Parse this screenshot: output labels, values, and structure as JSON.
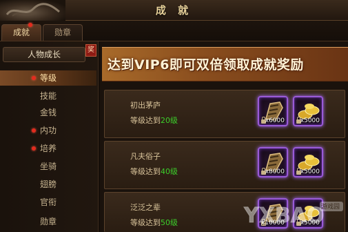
{
  "window": {
    "title": "成 就"
  },
  "tabs": [
    {
      "label": "成就",
      "active": true,
      "has_notice": true
    },
    {
      "label": "勋章",
      "active": false,
      "has_notice": false
    }
  ],
  "sidebar": {
    "header": "人物成长",
    "badge": "奖",
    "items": [
      {
        "label": "等级",
        "active": true,
        "has_notice": true
      },
      {
        "label": "技能",
        "active": false,
        "has_notice": false
      },
      {
        "label": "金钱",
        "active": false,
        "has_notice": false
      },
      {
        "label": "内功",
        "active": false,
        "has_notice": true
      },
      {
        "label": "培养",
        "active": false,
        "has_notice": true
      },
      {
        "label": "坐骑",
        "active": false,
        "has_notice": false
      },
      {
        "label": "翅膀",
        "active": false,
        "has_notice": false
      },
      {
        "label": "官衔",
        "active": false,
        "has_notice": false
      },
      {
        "label": "勋章",
        "active": false,
        "has_notice": false
      }
    ]
  },
  "banner": {
    "text": "达到VIP6即可双倍领取成就奖励"
  },
  "achievements": [
    {
      "name": "初出茅庐",
      "req_prefix": "等级达到",
      "req_level": "20级",
      "rewards": [
        {
          "icon": "bracer-item-icon",
          "count": "x6000"
        },
        {
          "icon": "gold-ingots-icon",
          "count": "x5000"
        }
      ]
    },
    {
      "name": "凡夫俗子",
      "req_prefix": "等级达到",
      "req_level": "40级",
      "rewards": [
        {
          "icon": "bracer-item-icon",
          "count": "x8000"
        },
        {
          "icon": "gold-ingots-icon",
          "count": "x5000"
        }
      ]
    },
    {
      "name": "泛泛之辈",
      "req_prefix": "等级达到",
      "req_level": "50级",
      "rewards": [
        {
          "icon": "bracer-item-icon",
          "count": "x10000"
        },
        {
          "icon": "gold-ingots-icon",
          "count": "x5000"
        }
      ]
    }
  ],
  "colors": {
    "accent_gold": "#e9d29a",
    "level_green": "#3ccf2b",
    "rare_purple": "#9a5ad8",
    "notice_red": "#e32b1e"
  },
  "watermark": {
    "brand": "游戏园"
  }
}
